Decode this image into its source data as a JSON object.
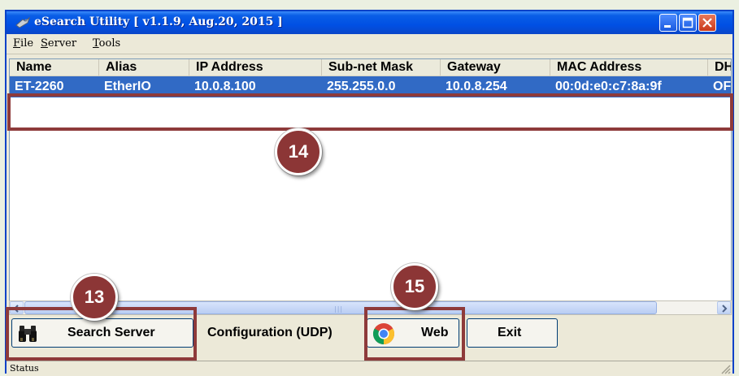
{
  "window": {
    "title": "eSearch Utility [ v1.1.9, Aug.20, 2015 ]"
  },
  "menu": [
    {
      "label": "File"
    },
    {
      "label": "Server"
    },
    {
      "label": "Tools"
    }
  ],
  "table": {
    "headers": [
      "Name",
      "Alias",
      "IP Address",
      "Sub-net Mask",
      "Gateway",
      "MAC Address",
      "DHCP"
    ],
    "rows": [
      [
        "ET-2260",
        "EtherIO",
        "10.0.8.100",
        "255.255.0.0",
        "10.0.8.254",
        "00:0d:e0:c7:8a:9f",
        "OFF"
      ]
    ]
  },
  "buttons": {
    "search_label": "Search Server",
    "config_label": "Configuration (UDP)",
    "web_label": "Web",
    "exit_label": "Exit"
  },
  "status": {
    "text": "Status"
  },
  "callouts": [
    {
      "number": "13"
    },
    {
      "number": "14"
    },
    {
      "number": "15"
    }
  ],
  "colors": {
    "selection": "#316ac5",
    "callout": "#8c3636",
    "titlebar": "#0050e4"
  },
  "icons": [
    "app-icon",
    "minimize-icon",
    "maximize-icon",
    "close-icon",
    "binoculars-icon",
    "chrome-icon",
    "size-grip-icon"
  ]
}
